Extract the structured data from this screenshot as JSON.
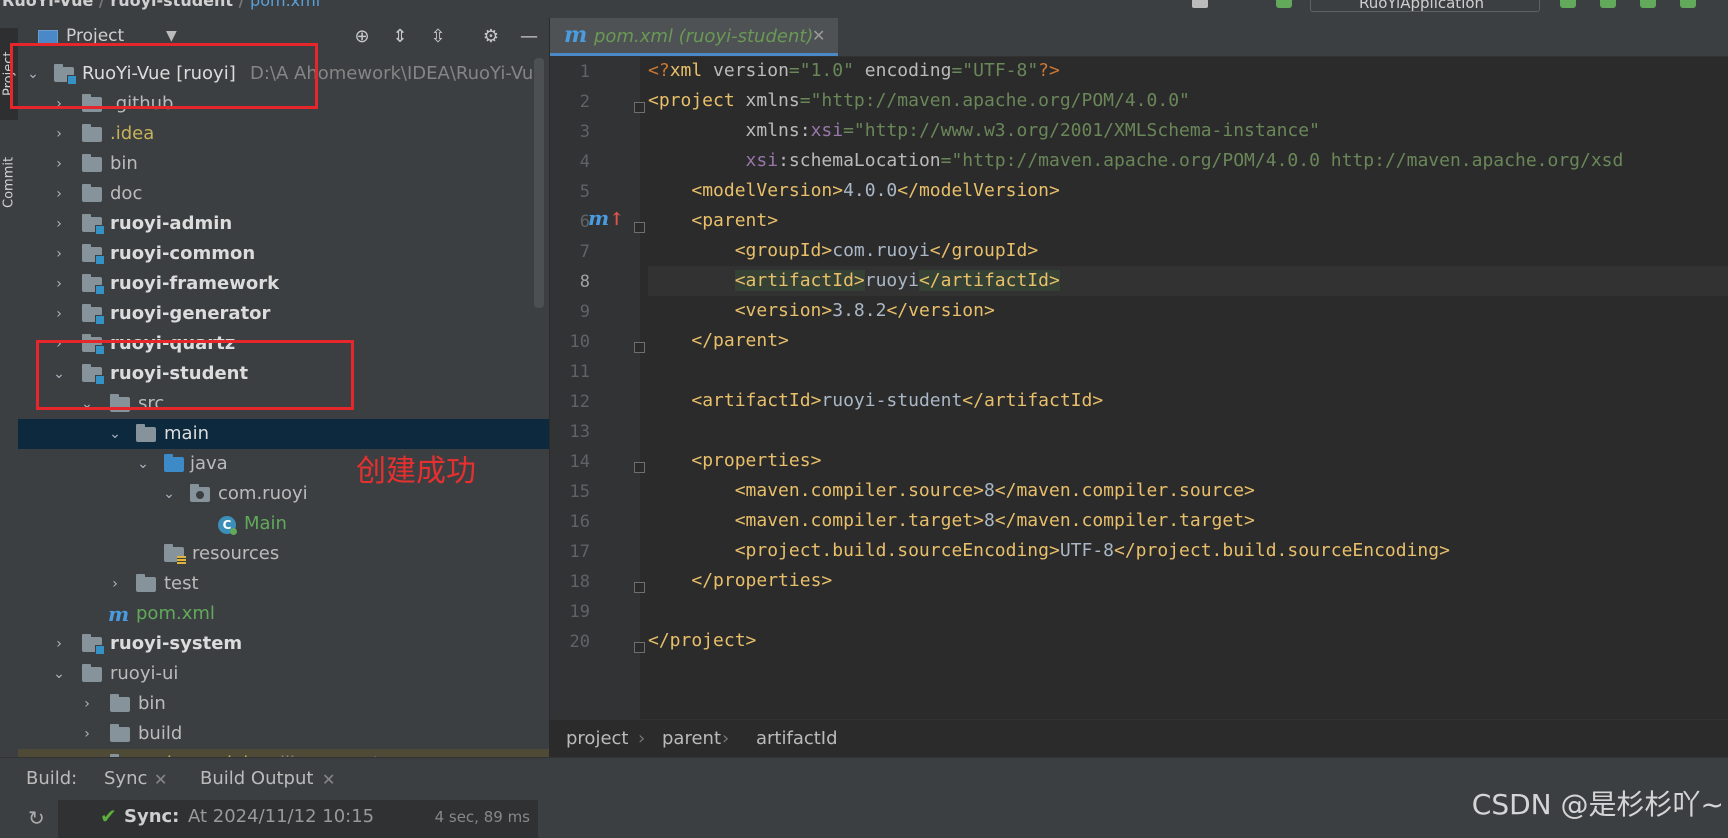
{
  "titlebar": {
    "crumb_root": "RuoYi-Vue",
    "crumb_module": "ruoyi-student",
    "crumb_file": "pom.xml",
    "run_config": "RuoYiApplication"
  },
  "left_strip": {
    "project_tab": "Project",
    "commit_tab": "Commit"
  },
  "project_panel": {
    "title": "Project",
    "tree": [
      {
        "label": "RuoYi-Vue [ruoyi]",
        "extra": "D:\\A Ahomework\\IDEA\\RuoYi-Vu",
        "expanded": true
      },
      {
        "label": ".github"
      },
      {
        "label": ".idea"
      },
      {
        "label": "bin"
      },
      {
        "label": "doc"
      },
      {
        "label": "ruoyi-admin"
      },
      {
        "label": "ruoyi-common"
      },
      {
        "label": "ruoyi-framework"
      },
      {
        "label": "ruoyi-generator"
      },
      {
        "label": "ruoyi-quartz"
      },
      {
        "label": "ruoyi-student",
        "expanded": true
      },
      {
        "label": "src",
        "expanded": true
      },
      {
        "label": "main",
        "expanded": true,
        "selected": true
      },
      {
        "label": "java",
        "expanded": true
      },
      {
        "label": "com.ruoyi",
        "expanded": true
      },
      {
        "label": "Main"
      },
      {
        "label": "resources"
      },
      {
        "label": "test"
      },
      {
        "label": "pom.xml"
      },
      {
        "label": "ruoyi-system"
      },
      {
        "label": "ruoyi-ui",
        "expanded": true
      },
      {
        "label": "bin"
      },
      {
        "label": "build"
      },
      {
        "label": "node_modules",
        "extra": "library root"
      }
    ],
    "annotation": "创建成功"
  },
  "editor": {
    "tab_label": "pom.xml (ruoyi-student)",
    "line_numbers": [
      "1",
      "2",
      "3",
      "4",
      "5",
      "6",
      "7",
      "8",
      "9",
      "10",
      "11",
      "12",
      "13",
      "14",
      "15",
      "16",
      "17",
      "18",
      "19",
      "20"
    ],
    "lines": [
      "<?xml version=\"1.0\" encoding=\"UTF-8\"?>",
      "<project xmlns=\"http://maven.apache.org/POM/4.0.0\"",
      "         xmlns:xsi=\"http://www.w3.org/2001/XMLSchema-instance\"",
      "         xsi:schemaLocation=\"http://maven.apache.org/POM/4.0.0 http://maven.apache.org/xsd",
      "    <modelVersion>4.0.0</modelVersion>",
      "    <parent>",
      "        <groupId>com.ruoyi</groupId>",
      "        <artifactId>ruoyi</artifactId>",
      "        <version>3.8.2</version>",
      "    </parent>",
      "",
      "    <artifactId>ruoyi-student</artifactId>",
      "",
      "    <properties>",
      "        <maven.compiler.source>8</maven.compiler.source>",
      "        <maven.compiler.target>8</maven.compiler.target>",
      "        <project.build.sourceEncoding>UTF-8</project.build.sourceEncoding>",
      "    </properties>",
      "",
      "</project>"
    ],
    "current_line": "8",
    "breadcrumb": [
      "project",
      "parent",
      "artifactId"
    ]
  },
  "build_panel": {
    "label": "Build:",
    "tabs": [
      "Sync",
      "Build Output"
    ],
    "status_label": "Sync:",
    "status_time": "At 2024/11/12 10:15",
    "duration": "4 sec, 89 ms"
  },
  "watermark": "CSDN @是杉杉吖~",
  "colors": {
    "tag": "#e8bf6a",
    "string": "#6a8759",
    "namespace": "#9876aa",
    "annotation_red": "#e5262a",
    "selection": "#0d293e"
  }
}
